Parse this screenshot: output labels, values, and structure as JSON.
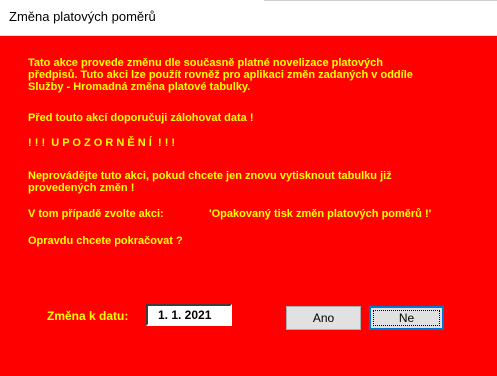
{
  "window": {
    "title": "Změna platových poměrů"
  },
  "message": {
    "paragraph1_line1": "Tato akce provede změnu dle současně platné novelizace platových",
    "paragraph1_line2": "předpisů. Tuto akci lze použít rovněž pro aplikaci změn zadaných v oddíle",
    "paragraph1_line3": "Služby - Hromadná změna platové tabulky.",
    "backup_note": "Před touto akcí doporučuji zálohovat data !",
    "warning_heading": "! ! !  U P O Z O R N Ě N Í  ! ! !",
    "paragraph2_line1": "Neprovádějte tuto akci, pokud chcete jen znovu vytisknout tabulku již",
    "paragraph2_line2": "provedených změn !",
    "alternative_prefix": "V tom případě zvolte akci:",
    "alternative_action": "'Opakovaný tisk změn platových poměrů !'",
    "confirm_question": "Opravdu chcete pokračovat ?"
  },
  "footer": {
    "date_label": "Změna k datu:",
    "date_value": "1. 1. 2021",
    "yes_label": "Ano",
    "no_label": "Ne"
  },
  "colors": {
    "background": "#ff0000",
    "text": "#ffff00",
    "focus_border": "#0078d7"
  }
}
